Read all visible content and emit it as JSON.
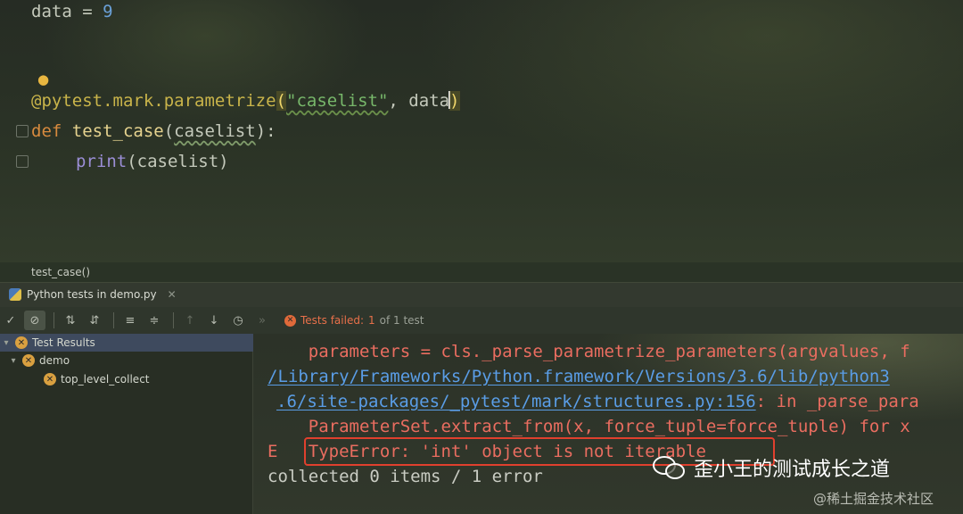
{
  "editor": {
    "line1": {
      "name": "data",
      "op": " = ",
      "value": "9"
    },
    "line_decorator": {
      "dec": "@pytest.mark.parametrize",
      "open": "(",
      "str": "\"caselist\"",
      "comma": ", ",
      "arg": "data",
      "close": ")"
    },
    "line_def": {
      "kw": "def ",
      "fn": "test_case",
      "open": "(",
      "param": "caselist",
      "close": "):"
    },
    "line_body": {
      "fn": "print",
      "args": "(caselist)"
    },
    "breadcrumb": "test_case()"
  },
  "run_panel": {
    "tab_label": "Python tests in demo.py",
    "status": {
      "failed": "Tests failed:",
      "count": "1",
      "rest": "of 1 test"
    },
    "tree": [
      {
        "label": "Test Results"
      },
      {
        "label": "demo"
      },
      {
        "label": "top_level_collect"
      }
    ],
    "console": {
      "l1": "    parameters = cls._parse_parametrize_parameters(argvalues, f",
      "l2": "/Library/Frameworks/Python.framework/Versions/3.6/lib/python3",
      "l3a": ".6/site-packages/_pytest/mark/structures.py:156",
      "l3b": ": in _parse_para",
      "l4": "    ParameterSet.extract_from(x, force_tuple=force_tuple) for x",
      "l5a": "E   ",
      "l5b": "TypeError: 'int' object is not iterable",
      "l6": "collected 0 items / 1 error"
    }
  },
  "watermark": {
    "main": "歪小王的测试成长之道",
    "sub": "@稀土掘金技术社区"
  }
}
